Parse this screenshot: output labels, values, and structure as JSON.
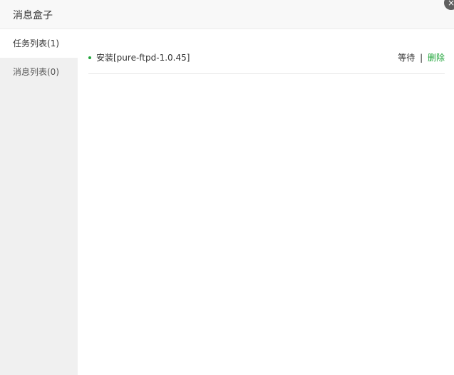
{
  "dialog": {
    "title": "消息盒子",
    "close_icon": "×"
  },
  "sidebar": {
    "items": [
      {
        "label": "任务列表(1)",
        "active": true
      },
      {
        "label": "消息列表(0)",
        "active": false
      }
    ]
  },
  "tasks": [
    {
      "name": "安装[pure-ftpd-1.0.45]",
      "status": "等待",
      "separator": "|",
      "delete_label": "删除"
    }
  ],
  "colors": {
    "accent": "#20a53a",
    "sidebar_bg": "#f0f0f0",
    "titlebar_bg": "#f8f8f8"
  }
}
